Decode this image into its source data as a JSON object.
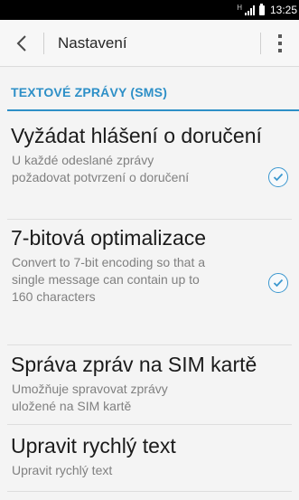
{
  "status_bar": {
    "network_label": "H",
    "time": "13:25"
  },
  "action_bar": {
    "title": "Nastavení"
  },
  "section": {
    "label": "TEXTOVÉ ZPRÁVY (SMS)"
  },
  "preferences": [
    {
      "title": "Vyžádat hlášení o doručení",
      "summary": "U každé odeslané zprávy požadovat potvrzení o doručení",
      "checked": true
    },
    {
      "title": "7-bitová optimalizace",
      "summary": "Convert to 7-bit encoding so that a single message can contain up to 160 characters",
      "checked": true
    },
    {
      "title": "Správa zpráv na SIM kartě",
      "summary": "Umožňuje spravovat zprávy uložené na SIM kartě"
    },
    {
      "title": "Upravit rychlý text",
      "summary": "Upravit rychlý text"
    }
  ],
  "colors": {
    "accent": "#2d8fc7",
    "status_bar": "#000000",
    "background": "#f4f4f4"
  }
}
